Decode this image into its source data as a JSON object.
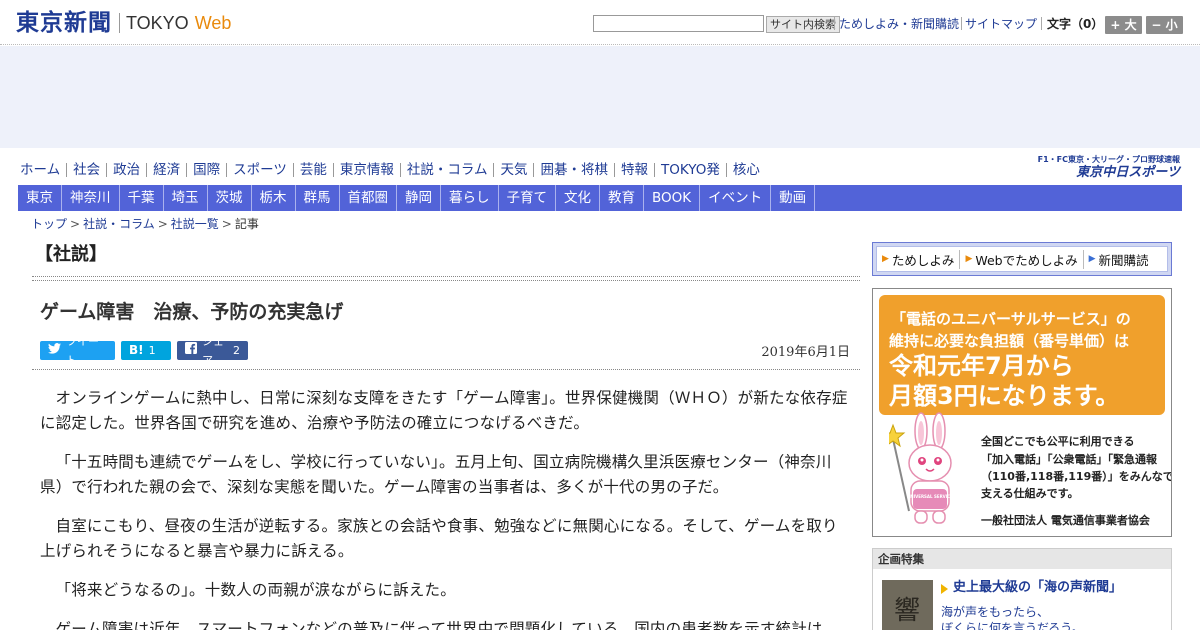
{
  "header": {
    "logo_jp": "東京新聞",
    "logo_en": "TOKYO",
    "logo_web": "Web",
    "search_button": "サイト内検索",
    "search_value": "",
    "link_trial": "ためしよみ・新聞購読",
    "link_sitemap": "サイトマップ",
    "font_label": "文字（0）",
    "font_larger": "+ 大",
    "font_smaller": "− 小"
  },
  "nav_main": {
    "items": [
      "ホーム",
      "社会",
      "政治",
      "経済",
      "国際",
      "スポーツ",
      "芸能",
      "東京情報",
      "社説・コラム",
      "天気",
      "囲碁・将棋",
      "特報",
      "TOKYO発",
      "核心"
    ],
    "chunichi_top": "F1・FC東京・大リーグ・プロ野球速報",
    "chunichi_bottom": "東京中日スポーツ"
  },
  "nav_sub": {
    "items": [
      "東京",
      "神奈川",
      "千葉",
      "埼玉",
      "茨城",
      "栃木",
      "群馬",
      "首都圏",
      "静岡",
      "暮らし",
      "子育て",
      "文化",
      "教育",
      "BOOK",
      "イベント",
      "動画"
    ]
  },
  "breadcrumb": {
    "top": "トップ",
    "column": "社説・コラム",
    "list": "社説一覧",
    "current": "記事",
    "sep": ">"
  },
  "article": {
    "section": "【社説】",
    "headline": "ゲーム障害　治療、予防の充実急げ",
    "tweet": "ツイート",
    "hatena_label": "B!",
    "hatena_count": "1",
    "fb_label": "シェア",
    "fb_count": "2",
    "date": "2019年6月1日",
    "paragraphs": [
      "オンラインゲームに熱中し、日常に深刻な支障をきたす「ゲーム障害」。世界保健機関（ＷＨＯ）が新たな依存症に認定した。世界各国で研究を進め、治療や予防法の確立につなげるべきだ。",
      "「十五時間も連続でゲームをし、学校に行っていない」。五月上旬、国立病院機構久里浜医療センター（神奈川県）で行われた親の会で、深刻な実態を聞いた。ゲーム障害の当事者は、多くが十代の男の子だ。",
      "自室にこもり、昼夜の生活が逆転する。家族との会話や食事、勉強などに無関心になる。そして、ゲームを取り上げられそうになると暴言や暴力に訴える。",
      "「将来どうなるの」。十数人の両親が涙ながらに訴えた。",
      "ゲーム障害は近年、スマートフォンなどの普及に伴って世界中で問題化している。国内の患者数を示す統計は"
    ]
  },
  "sidebar": {
    "sub_links": [
      "ためしよみ",
      "Webでためしよみ",
      "新聞購読"
    ],
    "ad": {
      "line1": "「電話のユニバーサルサービス」の",
      "line2": "維持に必要な負担額（番号単価）は",
      "line3": "令和元年7月から",
      "line4": "月額3円になります。",
      "text1": "全国どこでも公平に利用できる",
      "text2": "「加入電話」「公衆電話」「緊急通報",
      "text3": "（110番,118番,119番）」をみんなで",
      "text4": "支える仕組みです。",
      "org": "一般社団法人 電気通信事業者協会",
      "mascot_badge": "UNIVERSAL SERVICE"
    },
    "feature": {
      "heading": "企画特集",
      "title": "史上最大級の「海の声新聞」",
      "desc1": "海が声をもったら、",
      "desc2": "ぼくらに何を言うだろう。",
      "thumb_char": "響"
    }
  },
  "colors": {
    "brand": "#1f3b94",
    "subnav": "#5263d8",
    "accent_orange": "#e98a0c",
    "ad_orange": "#f0a02c"
  }
}
